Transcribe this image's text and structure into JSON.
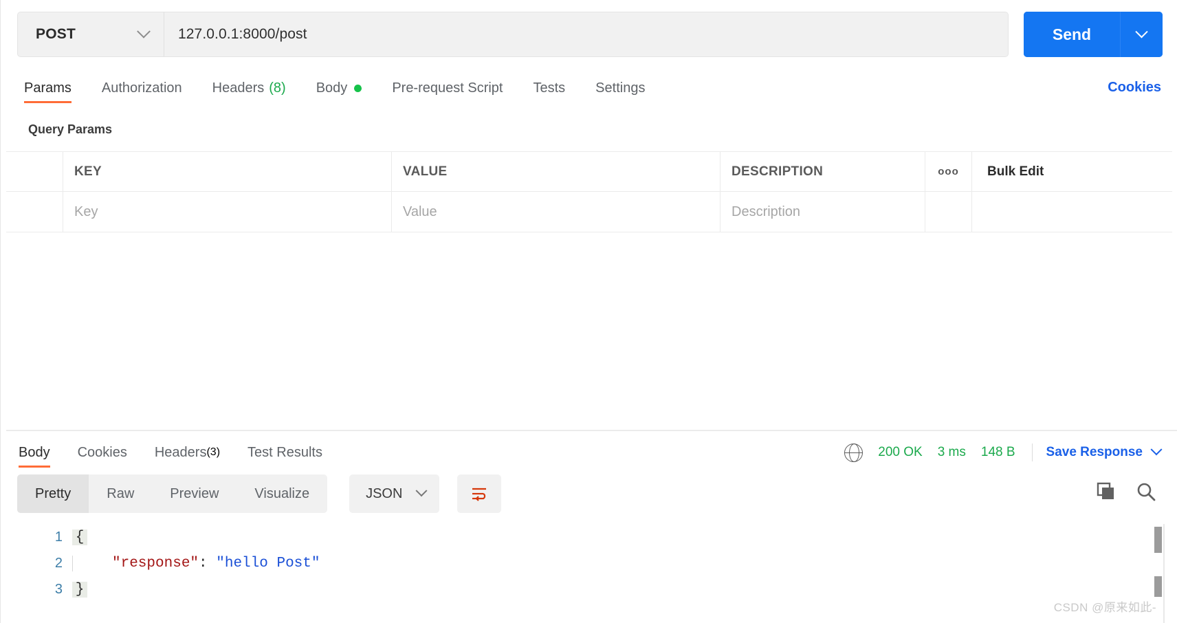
{
  "request": {
    "method": "POST",
    "url": "127.0.0.1:8000/post",
    "send_label": "Send",
    "cookies_label": "Cookies",
    "tabs": [
      {
        "label": "Params",
        "active": true
      },
      {
        "label": "Authorization",
        "active": false
      },
      {
        "label": "Headers",
        "count": "(8)",
        "active": false
      },
      {
        "label": "Body",
        "dot": true,
        "active": false
      },
      {
        "label": "Pre-request Script",
        "active": false
      },
      {
        "label": "Tests",
        "active": false
      },
      {
        "label": "Settings",
        "active": false
      }
    ]
  },
  "params": {
    "section_title": "Query Params",
    "headers": {
      "key": "KEY",
      "value": "VALUE",
      "description": "DESCRIPTION",
      "more": "ooo",
      "bulk_edit": "Bulk Edit"
    },
    "placeholders": {
      "key": "Key",
      "value": "Value",
      "description": "Description"
    }
  },
  "response": {
    "tabs": [
      {
        "label": "Body",
        "active": true
      },
      {
        "label": "Cookies",
        "active": false
      },
      {
        "label": "Headers",
        "count": "(3)",
        "active": false
      },
      {
        "label": "Test Results",
        "active": false
      }
    ],
    "status": "200 OK",
    "time": "3 ms",
    "size": "148 B",
    "save_label": "Save Response",
    "view_modes": [
      {
        "label": "Pretty",
        "active": true
      },
      {
        "label": "Raw",
        "active": false
      },
      {
        "label": "Preview",
        "active": false
      },
      {
        "label": "Visualize",
        "active": false
      }
    ],
    "format": "JSON",
    "body_lines": [
      {
        "num": "1",
        "fold": "{",
        "open": true,
        "text": ""
      },
      {
        "num": "2",
        "fold": "",
        "open": false,
        "key": "\"response\"",
        "sep": ": ",
        "value": "\"hello Post\""
      },
      {
        "num": "3",
        "fold": "}",
        "open": true,
        "text": ""
      }
    ]
  },
  "colors": {
    "accent_orange": "#ff6c37",
    "primary_blue": "#1476f2",
    "link_blue": "#1a60e8",
    "status_green": "#1ba94c",
    "json_key_red": "#a31515",
    "json_string_blue": "#1a4fd6"
  },
  "watermark": "CSDN @原来如此-"
}
